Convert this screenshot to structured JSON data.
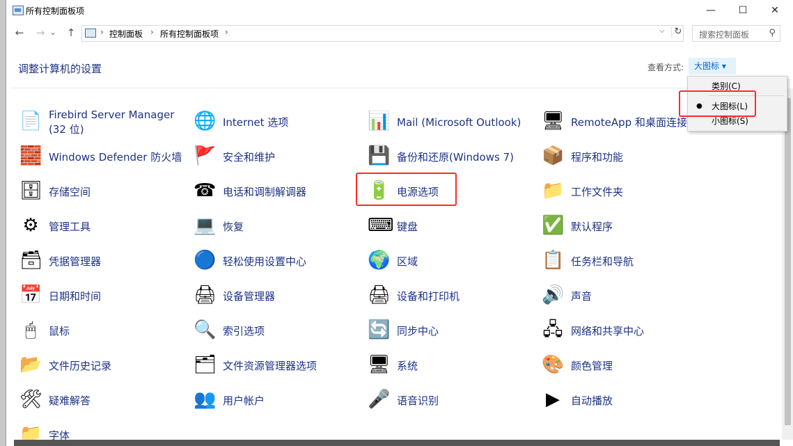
{
  "window": {
    "title": "所有控制面板项",
    "minimize": "—",
    "maximize": "☐",
    "close": "✕"
  },
  "address": {
    "crumb1": "控制面板",
    "crumb2": "所有控制面板项",
    "separator": "›",
    "dropdown": "⌵",
    "refresh": "↻",
    "search_placeholder": "搜索控制面板",
    "back": "←",
    "forward": "→",
    "recent": "⌄",
    "up": "↑"
  },
  "header": {
    "heading": "调整计算机的设置",
    "view_label": "查看方式:",
    "view_value": "大图标 ▾"
  },
  "dropdown": {
    "items": [
      "类别(C)",
      "大图标(L)",
      "小图标(S)"
    ],
    "selected_bullet": "●"
  },
  "items": [
    {
      "label": "Firebird Server Manager (32 位)",
      "icon": "📄",
      "icon_name": "firebird-icon"
    },
    {
      "label": "Internet 选项",
      "icon": "🌐",
      "icon_name": "internet-options-icon"
    },
    {
      "label": "Mail (Microsoft Outlook)",
      "icon": "📊",
      "icon_name": "mail-icon"
    },
    {
      "label": "RemoteApp 和桌面连接",
      "icon": "🖥",
      "icon_name": "remoteapp-icon"
    },
    {
      "label": "Windows Defender 防火墙",
      "icon": "🧱",
      "icon_name": "firewall-icon"
    },
    {
      "label": "安全和维护",
      "icon": "🚩",
      "icon_name": "security-flag-icon"
    },
    {
      "label": "备份和还原(Windows 7)",
      "icon": "💾",
      "icon_name": "backup-icon"
    },
    {
      "label": "程序和功能",
      "icon": "📦",
      "icon_name": "programs-icon"
    },
    {
      "label": "存储空间",
      "icon": "🗄",
      "icon_name": "storage-icon"
    },
    {
      "label": "电话和调制解调器",
      "icon": "☎",
      "icon_name": "phone-modem-icon"
    },
    {
      "label": "电源选项",
      "icon": "🔋",
      "icon_name": "power-options-icon"
    },
    {
      "label": "工作文件夹",
      "icon": "📁",
      "icon_name": "work-folders-icon"
    },
    {
      "label": "管理工具",
      "icon": "⚙",
      "icon_name": "admin-tools-icon"
    },
    {
      "label": "恢复",
      "icon": "💻",
      "icon_name": "recovery-icon"
    },
    {
      "label": "键盘",
      "icon": "⌨",
      "icon_name": "keyboard-icon"
    },
    {
      "label": "默认程序",
      "icon": "✅",
      "icon_name": "default-programs-icon"
    },
    {
      "label": "凭据管理器",
      "icon": "🗃",
      "icon_name": "credential-manager-icon"
    },
    {
      "label": "轻松使用设置中心",
      "icon": "🔵",
      "icon_name": "ease-of-access-icon"
    },
    {
      "label": "区域",
      "icon": "🌍",
      "icon_name": "region-icon"
    },
    {
      "label": "任务栏和导航",
      "icon": "📋",
      "icon_name": "taskbar-icon"
    },
    {
      "label": "日期和时间",
      "icon": "📅",
      "icon_name": "date-time-icon"
    },
    {
      "label": "设备管理器",
      "icon": "🖨",
      "icon_name": "device-manager-icon"
    },
    {
      "label": "设备和打印机",
      "icon": "🖨",
      "icon_name": "devices-printers-icon"
    },
    {
      "label": "声音",
      "icon": "🔊",
      "icon_name": "sound-icon"
    },
    {
      "label": "鼠标",
      "icon": "🖱",
      "icon_name": "mouse-icon"
    },
    {
      "label": "索引选项",
      "icon": "🔍",
      "icon_name": "indexing-icon"
    },
    {
      "label": "同步中心",
      "icon": "🔄",
      "icon_name": "sync-center-icon"
    },
    {
      "label": "网络和共享中心",
      "icon": "🖧",
      "icon_name": "network-icon"
    },
    {
      "label": "文件历史记录",
      "icon": "📂",
      "icon_name": "file-history-icon"
    },
    {
      "label": "文件资源管理器选项",
      "icon": "🗂",
      "icon_name": "explorer-options-icon"
    },
    {
      "label": "系统",
      "icon": "🖥",
      "icon_name": "system-icon"
    },
    {
      "label": "颜色管理",
      "icon": "🎨",
      "icon_name": "color-management-icon"
    },
    {
      "label": "疑难解答",
      "icon": "🛠",
      "icon_name": "troubleshooting-icon"
    },
    {
      "label": "用户帐户",
      "icon": "👥",
      "icon_name": "user-accounts-icon"
    },
    {
      "label": "语音识别",
      "icon": "🎤",
      "icon_name": "speech-icon"
    },
    {
      "label": "自动播放",
      "icon": "▶",
      "icon_name": "autoplay-icon"
    },
    {
      "label": "字体",
      "icon": "📁",
      "icon_name": "fonts-icon"
    }
  ],
  "colors": {
    "link": "#1e3287",
    "highlight": "#ff2a2a",
    "view_button_bg": "#e5f1fb"
  }
}
